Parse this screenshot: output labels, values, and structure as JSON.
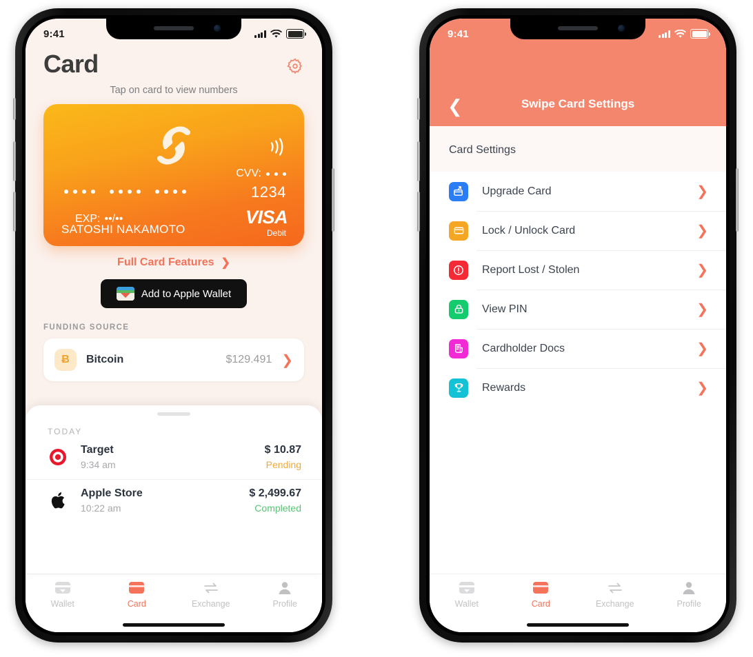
{
  "status_bar": {
    "time": "9:41",
    "signal": "cellular-bars-icon",
    "wifi": "wifi-icon",
    "battery": "battery-full-icon"
  },
  "card_screen": {
    "title": "Card",
    "settings_icon": "gear-icon",
    "hint": "Tap on card to view numbers",
    "card": {
      "brand_logo": "swipe-logo",
      "contactless_icon": "contactless-icon",
      "cvv_label": "CVV:",
      "last_four": "1234",
      "exp_label": "EXP:",
      "exp_value": "••/••",
      "holder": "SATOSHI NAKAMOTO",
      "network": "VISA",
      "type": "Debit"
    },
    "full_features_label": "Full Card Features",
    "apple_wallet_label": "Add to Apple Wallet",
    "apple_wallet_icon": "apple-wallet-icon",
    "funding_label": "FUNDING SOURCE",
    "funding": {
      "icon_glyph": "Ƀ",
      "name": "Bitcoin",
      "amount": "$129.491"
    },
    "sheet": {
      "section_label": "TODAY",
      "transactions": [
        {
          "merchant": "Target",
          "icon": "target-logo-icon",
          "time": "9:34 am",
          "amount": "$ 10.87",
          "status": "Pending",
          "status_color": "#f0a93c"
        },
        {
          "merchant": "Apple Store",
          "icon": "apple-logo-icon",
          "time": "10:22 am",
          "amount": "$ 2,499.67",
          "status": "Completed",
          "status_color": "#56c472"
        }
      ]
    }
  },
  "settings_screen": {
    "back_icon": "chevron-left-icon",
    "nav_title": "Swipe Card Settings",
    "section_header": "Card Settings",
    "rows": [
      {
        "label": "Upgrade Card",
        "icon": "upgrade-card-icon",
        "color": "#2a7df4"
      },
      {
        "label": "Lock / Unlock Card",
        "icon": "lock-card-icon",
        "color": "#f5a623"
      },
      {
        "label": "Report Lost / Stolen",
        "icon": "report-lost-icon",
        "color": "#f42a36"
      },
      {
        "label": "View PIN",
        "icon": "view-pin-icon",
        "color": "#14cc6e"
      },
      {
        "label": "Cardholder Docs",
        "icon": "cardholder-docs-icon",
        "color": "#f22ad6"
      },
      {
        "label": "Rewards",
        "icon": "rewards-icon",
        "color": "#14c2d6"
      }
    ]
  },
  "tab_bar": {
    "tabs": [
      {
        "label": "Wallet",
        "icon": "wallet-icon",
        "active": false
      },
      {
        "label": "Card",
        "icon": "card-icon",
        "active": true
      },
      {
        "label": "Exchange",
        "icon": "exchange-icon",
        "active": false
      },
      {
        "label": "Profile",
        "icon": "profile-icon",
        "active": false
      }
    ],
    "accent_color": "#f4735a",
    "inactive_color": "#c2c2c4"
  }
}
